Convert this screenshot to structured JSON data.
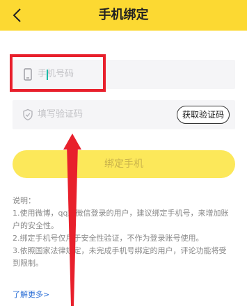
{
  "header": {
    "title": "手机绑定",
    "back_icon": "chevron-left-icon"
  },
  "phone": {
    "placeholder": "手机号码",
    "icon": "phone-icon"
  },
  "code": {
    "placeholder": "填写验证码",
    "icon": "shield-icon",
    "get_code_label": "获取验证码"
  },
  "bind_button": "绑定手机",
  "notes": {
    "heading": "说明：",
    "items": [
      "1.使用微博，qq或微信登录的用户，建议绑定手机号，来增加账户的安全性。",
      "2.绑定手机号仅用于安全性验证，不作为登录账号使用。",
      "3.依照国家法律规定，未完成手机号绑定的用户，评论功能将受到限制。"
    ]
  },
  "more_link": "了解更多>",
  "colors": {
    "header": "#fcd932",
    "button": "#fce85a",
    "highlight": "#e8202c",
    "link": "#2c6fd6"
  }
}
